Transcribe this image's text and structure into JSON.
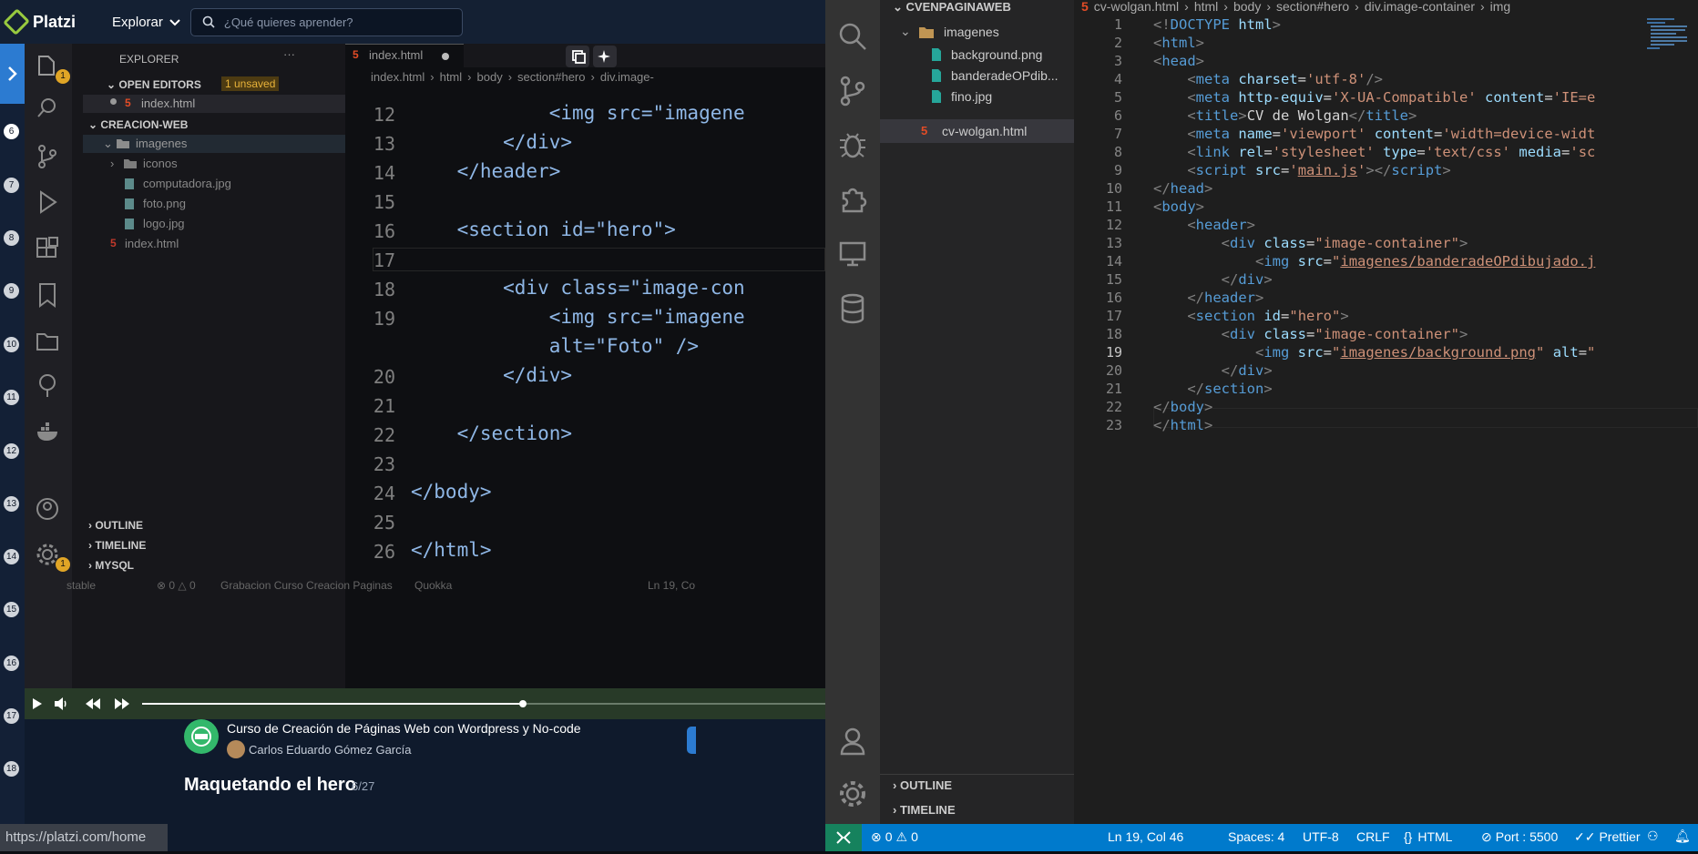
{
  "platzi": {
    "logo": "Platzi",
    "nav_explore": "Explorar",
    "search_placeholder": "¿Qué quieres aprender?",
    "lesson_numbers": [
      "6",
      "7",
      "8",
      "9",
      "10",
      "11",
      "12",
      "13",
      "14",
      "15",
      "16",
      "17",
      "18"
    ],
    "course_title": "Curso de Creación de Páginas Web con Wordpress y No-code",
    "instructor": "Carlos Eduardo Gómez García",
    "lesson_title": "Maquetando el hero",
    "lesson_progress": "6/27",
    "url_hint": "https://platzi.com/home"
  },
  "video": {
    "explorer_title": "EXPLORER",
    "open_editors": "OPEN EDITORS",
    "unsaved_badge": "1 unsaved",
    "open_file": "index.html",
    "project": "CREACION-WEB",
    "tree": [
      "imagenes",
      "iconos",
      "computadora.jpg",
      "foto.png",
      "logo.jpg",
      "index.html"
    ],
    "outline": "OUTLINE",
    "timeline": "TIMELINE",
    "mysql": "MYSQL",
    "tab": "index.html",
    "breadcrumb": [
      "index.html",
      "html",
      "body",
      "section#hero",
      "div.image-"
    ],
    "badge_count": "1",
    "status_left": "stable",
    "status_problems": "⊗ 0 △ 0",
    "status_folder": "Grabacion Curso Creacion Paginas",
    "status_quokka": "Quokka",
    "status_pos": "Ln 19, Co",
    "code": [
      {
        "n": "12",
        "t": "            <img src=\"imagene"
      },
      {
        "n": "13",
        "t": "        </div>"
      },
      {
        "n": "14",
        "t": "    </header>"
      },
      {
        "n": "15",
        "t": ""
      },
      {
        "n": "16",
        "t": "    <section id=\"hero\">"
      },
      {
        "n": "17",
        "t": ""
      },
      {
        "n": "18",
        "t": "        <div class=\"image-con"
      },
      {
        "n": "19",
        "t": "            <img src=\"imagene"
      },
      {
        "n": "",
        "t": "            alt=\"Foto\" />"
      },
      {
        "n": "20",
        "t": "        </div>"
      },
      {
        "n": "21",
        "t": ""
      },
      {
        "n": "22",
        "t": "    </section>"
      },
      {
        "n": "23",
        "t": ""
      },
      {
        "n": "24",
        "t": "</body>"
      },
      {
        "n": "25",
        "t": ""
      },
      {
        "n": "26",
        "t": "</html>"
      }
    ]
  },
  "vscode": {
    "tab": "cv-wolgan.html",
    "breadcrumb": [
      "html",
      "body",
      "section#hero",
      "div.image-container",
      "img"
    ],
    "project": "CVENPAGINAWEB",
    "folder": "imagenes",
    "files": [
      "background.png",
      "banderadeOPdib...",
      "fino.jpg"
    ],
    "active_file": "cv-wolgan.html",
    "outline": "OUTLINE",
    "timeline": "TIMELINE",
    "lines": [
      {
        "n": "1",
        "h": "<span class='br'>&lt;!</span><span class='tg'>DOCTYPE</span> <span class='at'>html</span><span class='br'>&gt;</span>"
      },
      {
        "n": "2",
        "h": "<span class='br'>&lt;</span><span class='tg'>html</span><span class='br'>&gt;</span>"
      },
      {
        "n": "3",
        "h": "<span class='br'>&lt;</span><span class='tg'>head</span><span class='br'>&gt;</span>"
      },
      {
        "n": "4",
        "h": "    <span class='br'>&lt;</span><span class='tg'>meta</span> <span class='at'>charset</span>=<span class='sv'>'utf-8'</span><span class='br'>/&gt;</span>"
      },
      {
        "n": "5",
        "h": "    <span class='br'>&lt;</span><span class='tg'>meta</span> <span class='at'>http-equiv</span>=<span class='sv'>'X-UA-Compatible'</span> <span class='at'>content</span>=<span class='sv'>'IE=e</span>"
      },
      {
        "n": "6",
        "h": "    <span class='br'>&lt;</span><span class='tg'>title</span><span class='br'>&gt;</span>CV de Wolgan<span class='br'>&lt;/</span><span class='tg'>title</span><span class='br'>&gt;</span>"
      },
      {
        "n": "7",
        "h": "    <span class='br'>&lt;</span><span class='tg'>meta</span> <span class='at'>name</span>=<span class='sv'>'viewport'</span> <span class='at'>content</span>=<span class='sv'>'width=device-widt</span>"
      },
      {
        "n": "8",
        "h": "    <span class='br'>&lt;</span><span class='tg'>link</span> <span class='at'>rel</span>=<span class='sv'>'stylesheet'</span> <span class='at'>type</span>=<span class='sv'>'text/css'</span> <span class='at'>media</span>=<span class='sv'>'sc</span>"
      },
      {
        "n": "9",
        "h": "    <span class='br'>&lt;</span><span class='tg'>script</span> <span class='at'>src</span>=<span class='sv'>'<u>main.js</u>'</span><span class='br'>&gt;&lt;/</span><span class='tg'>script</span><span class='br'>&gt;</span>"
      },
      {
        "n": "10",
        "h": "<span class='br'>&lt;/</span><span class='tg'>head</span><span class='br'>&gt;</span>"
      },
      {
        "n": "11",
        "h": "<span class='br'>&lt;</span><span class='tg'>body</span><span class='br'>&gt;</span>"
      },
      {
        "n": "12",
        "h": "    <span class='br'>&lt;</span><span class='tg'>header</span><span class='br'>&gt;</span>"
      },
      {
        "n": "13",
        "h": "        <span class='br'>&lt;</span><span class='tg'>div</span> <span class='at'>class</span>=<span class='sv'>\"image-container\"</span><span class='br'>&gt;</span>"
      },
      {
        "n": "14",
        "h": "            <span class='br'>&lt;</span><span class='tg'>img</span> <span class='at'>src</span>=<span class='sv'>\"<u>imagenes/banderadeOPdibujado.j</u></span>"
      },
      {
        "n": "15",
        "h": "        <span class='br'>&lt;/</span><span class='tg'>div</span><span class='br'>&gt;</span>"
      },
      {
        "n": "16",
        "h": "    <span class='br'>&lt;/</span><span class='tg'>header</span><span class='br'>&gt;</span>"
      },
      {
        "n": "17",
        "h": "    <span class='br'>&lt;</span><span class='tg'>section</span> <span class='at'>id</span>=<span class='sv'>\"hero\"</span><span class='br'>&gt;</span>"
      },
      {
        "n": "18",
        "h": "        <span class='br'>&lt;</span><span class='tg'>div</span> <span class='at'>class</span>=<span class='sv'>\"image-container\"</span><span class='br'>&gt;</span>"
      },
      {
        "n": "19",
        "h": "            <span class='br'>&lt;</span><span class='tg'>img</span> <span class='at'>src</span>=<span class='sv'>\"<u>imagenes/background.png</u>\"</span> <span class='at'>alt</span>=<span class='sv'>\"</span>"
      },
      {
        "n": "20",
        "h": "        <span class='br'>&lt;/</span><span class='tg'>div</span><span class='br'>&gt;</span>"
      },
      {
        "n": "21",
        "h": "    <span class='br'>&lt;/</span><span class='tg'>section</span><span class='br'>&gt;</span>"
      },
      {
        "n": "22",
        "h": "<span class='br'>&lt;/</span><span class='tg'>body</span><span class='br'>&gt;</span>"
      },
      {
        "n": "23",
        "h": "<span class='br'>&lt;/</span><span class='tg'>html</span><span class='br'>&gt;</span>"
      }
    ],
    "status": {
      "problems": "0",
      "warnings": "0",
      "position": "Ln 19, Col 46",
      "spaces": "Spaces: 4",
      "encoding": "UTF-8",
      "eol": "CRLF",
      "language": "HTML",
      "port": "Port : 5500",
      "prettier": "Prettier"
    }
  }
}
